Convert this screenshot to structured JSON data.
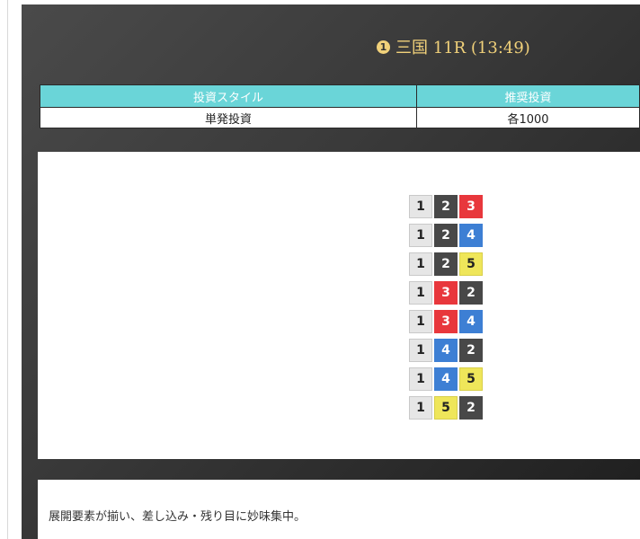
{
  "race": {
    "badge": "1",
    "title": "三国 11R (13:49)"
  },
  "style_table": {
    "headers": [
      "投資スタイル",
      "推奨投資"
    ],
    "values": [
      "単発投資",
      "各1000"
    ]
  },
  "picks": [
    [
      "1",
      "2",
      "3"
    ],
    [
      "1",
      "2",
      "4"
    ],
    [
      "1",
      "2",
      "5"
    ],
    [
      "1",
      "3",
      "2"
    ],
    [
      "1",
      "3",
      "4"
    ],
    [
      "1",
      "4",
      "2"
    ],
    [
      "1",
      "4",
      "5"
    ],
    [
      "1",
      "5",
      "2"
    ]
  ],
  "boat_colors": {
    "1": "#e6e6e6",
    "2": "#484848",
    "3": "#e8373c",
    "4": "#3d7fd4",
    "5": "#efe65a"
  },
  "comment": "展開要素が揃い、差し込み・残り目に妙味集中。"
}
